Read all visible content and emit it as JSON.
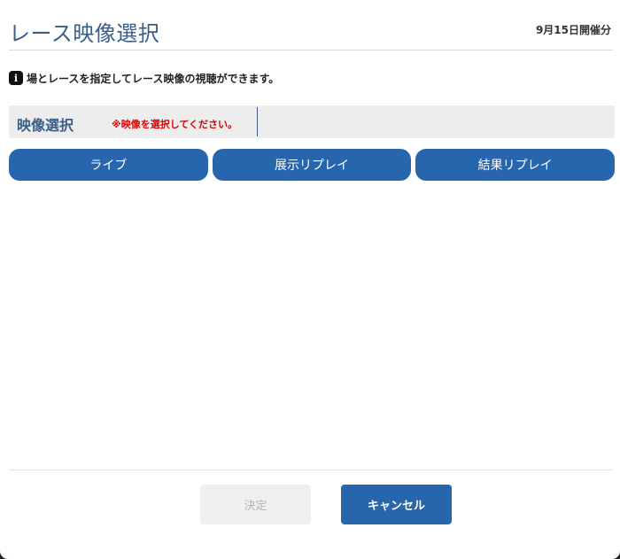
{
  "header": {
    "title": "レース映像選択",
    "date": "9月15日開催分"
  },
  "info": {
    "icon": "info-icon",
    "icon_glyph": "i",
    "text": "場とレースを指定してレース映像の視聴ができます。"
  },
  "selection": {
    "label": "映像選択",
    "note": "※映像を選択してください。"
  },
  "tabs": [
    {
      "label": "ライブ"
    },
    {
      "label": "展示リプレイ"
    },
    {
      "label": "結果リプレイ"
    }
  ],
  "footer": {
    "confirm_label": "決定",
    "cancel_label": "キャンセル"
  },
  "colors": {
    "accent": "#2766ac",
    "title": "#3a5f86",
    "warning": "#e00000"
  }
}
